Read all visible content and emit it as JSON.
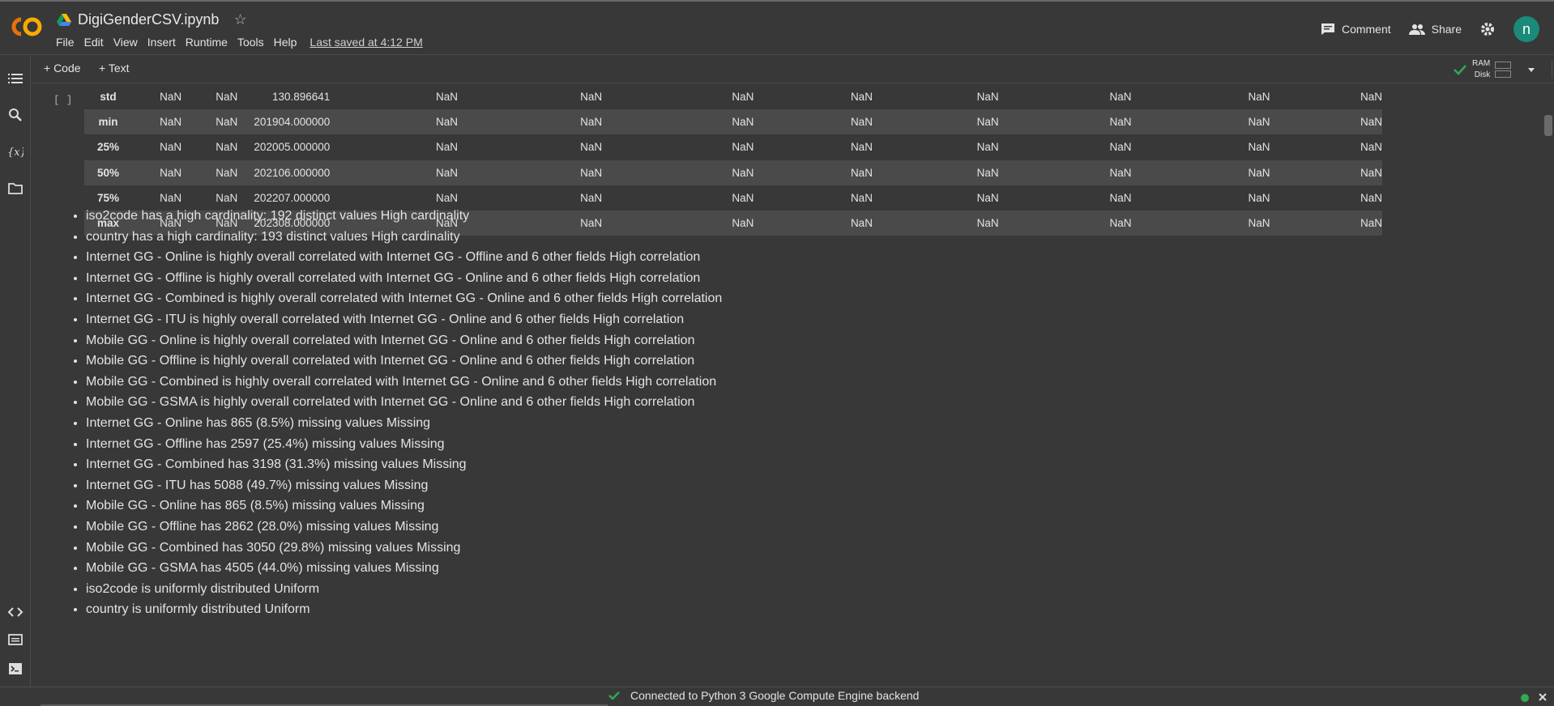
{
  "header": {
    "notebook_title": "DigiGenderCSV.ipynb",
    "menu": [
      "File",
      "Edit",
      "View",
      "Insert",
      "Runtime",
      "Tools",
      "Help"
    ],
    "last_saved": "Last saved at 4:12 PM",
    "comment_label": "Comment",
    "share_label": "Share",
    "avatar_letter": "n"
  },
  "toolbar": {
    "code_label": "+ Code",
    "text_label": "+ Text",
    "ram_label": "RAM",
    "disk_label": "Disk"
  },
  "cell": {
    "run_bracket": "[ ]"
  },
  "stats_table": {
    "rows": [
      {
        "label": "std",
        "c1": "NaN",
        "c2": "NaN",
        "c3": "130.896641",
        "rest": [
          "NaN",
          "NaN",
          "NaN",
          "NaN",
          "NaN",
          "NaN",
          "NaN",
          "NaN"
        ]
      },
      {
        "label": "min",
        "c1": "NaN",
        "c2": "NaN",
        "c3": "201904.000000",
        "rest": [
          "NaN",
          "NaN",
          "NaN",
          "NaN",
          "NaN",
          "NaN",
          "NaN",
          "NaN"
        ]
      },
      {
        "label": "25%",
        "c1": "NaN",
        "c2": "NaN",
        "c3": "202005.000000",
        "rest": [
          "NaN",
          "NaN",
          "NaN",
          "NaN",
          "NaN",
          "NaN",
          "NaN",
          "NaN"
        ]
      },
      {
        "label": "50%",
        "c1": "NaN",
        "c2": "NaN",
        "c3": "202106.000000",
        "rest": [
          "NaN",
          "NaN",
          "NaN",
          "NaN",
          "NaN",
          "NaN",
          "NaN",
          "NaN"
        ]
      },
      {
        "label": "75%",
        "c1": "NaN",
        "c2": "NaN",
        "c3": "202207.000000",
        "rest": [
          "NaN",
          "NaN",
          "NaN",
          "NaN",
          "NaN",
          "NaN",
          "NaN",
          "NaN"
        ]
      },
      {
        "label": "max",
        "c1": "NaN",
        "c2": "NaN",
        "c3": "202308.000000",
        "rest": [
          "NaN",
          "NaN",
          "NaN",
          "NaN",
          "NaN",
          "NaN",
          "NaN",
          "NaN"
        ]
      }
    ]
  },
  "alerts": [
    "iso2code has a high cardinality: 192 distinct values High cardinality",
    "country has a high cardinality: 193 distinct values High cardinality",
    "Internet GG - Online is highly overall correlated with Internet GG - Offline and 6 other fields High correlation",
    "Internet GG - Offline is highly overall correlated with Internet GG - Online and 6 other fields High correlation",
    "Internet GG - Combined is highly overall correlated with Internet GG - Online and 6 other fields High correlation",
    "Internet GG - ITU is highly overall correlated with Internet GG - Online and 6 other fields High correlation",
    "Mobile GG - Online is highly overall correlated with Internet GG - Online and 6 other fields High correlation",
    "Mobile GG - Offline is highly overall correlated with Internet GG - Online and 6 other fields High correlation",
    "Mobile GG - Combined is highly overall correlated with Internet GG - Online and 6 other fields High correlation",
    "Mobile GG - GSMA is highly overall correlated with Internet GG - Online and 6 other fields High correlation",
    "Internet GG - Online has 865 (8.5%) missing values Missing",
    "Internet GG - Offline has 2597 (25.4%) missing values Missing",
    "Internet GG - Combined has 3198 (31.3%) missing values Missing",
    "Internet GG - ITU has 5088 (49.7%) missing values Missing",
    "Mobile GG - Online has 865 (8.5%) missing values Missing",
    "Mobile GG - Offline has 2862 (28.0%) missing values Missing",
    "Mobile GG - Combined has 3050 (29.8%) missing values Missing",
    "Mobile GG - GSMA has 4505 (44.0%) missing values Missing",
    "iso2code is uniformly distributed Uniform",
    "country is uniformly distributed Uniform"
  ],
  "status": {
    "text": "Connected to Python 3 Google Compute Engine backend"
  },
  "colors": {
    "background": "#383838",
    "row_stripe": "#4a4a4a",
    "avatar": "#1a8a7a",
    "logo_orange": "#f9ab00",
    "logo_dark_orange": "#e8710a",
    "ok_green": "#34a853"
  }
}
